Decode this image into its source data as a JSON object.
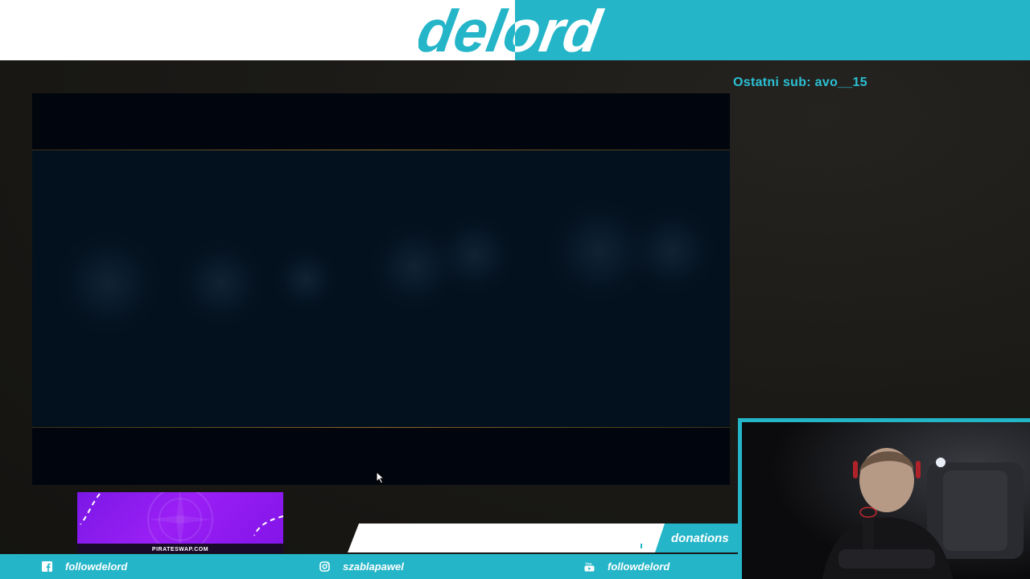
{
  "header": {
    "logo_text": "delord",
    "colors": {
      "left": "#ffffff",
      "right": "#24b5c8"
    }
  },
  "last_sub": {
    "text": "Ostatni sub: avo__15"
  },
  "game": {
    "description_colors": {
      "bg": "#03101d",
      "line": "#8a6a2a"
    }
  },
  "sponsor": {
    "text": "PIRATESWAP.COM",
    "color": "#8a1cf0"
  },
  "donations": {
    "label": "donations"
  },
  "social": [
    {
      "icon": "facebook-icon",
      "handle": "followdelord"
    },
    {
      "icon": "instagram-icon",
      "handle": "szablapawel"
    },
    {
      "icon": "youtube-icon",
      "handle": "followdelord"
    }
  ],
  "accent_color": "#24b5c8"
}
